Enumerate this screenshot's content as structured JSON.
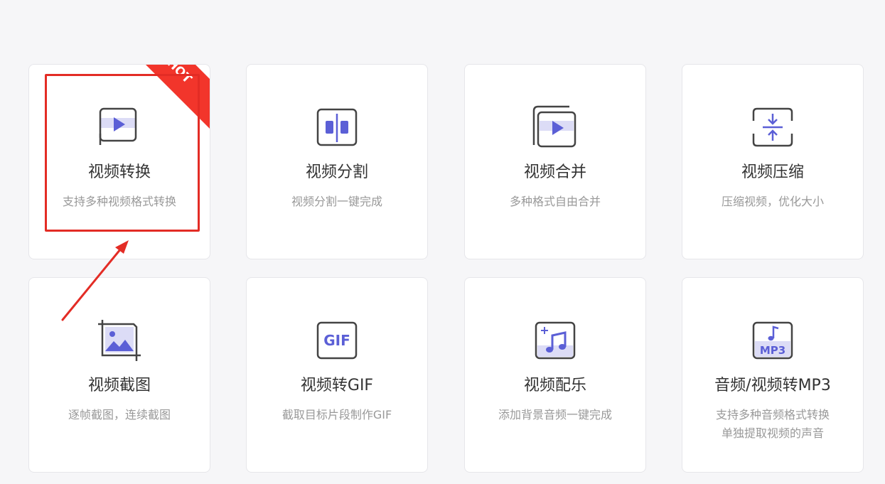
{
  "accent_color": "#5b5fd6",
  "hot_color": "#f2352b",
  "cards": [
    {
      "title": "视频转换",
      "desc": [
        "支持多种视频格式转换"
      ],
      "icon": "video-convert-icon",
      "badge": "HOT"
    },
    {
      "title": "视频分割",
      "desc": [
        "视频分割一键完成"
      ],
      "icon": "video-split-icon"
    },
    {
      "title": "视频合并",
      "desc": [
        "多种格式自由合并"
      ],
      "icon": "video-merge-icon"
    },
    {
      "title": "视频压缩",
      "desc": [
        "压缩视频，优化大小"
      ],
      "icon": "video-compress-icon"
    },
    {
      "title": "视频截图",
      "desc": [
        "逐帧截图，连续截图"
      ],
      "icon": "video-screenshot-icon"
    },
    {
      "title": "视频转GIF",
      "desc": [
        "截取目标片段制作GIF"
      ],
      "icon": "gif-icon",
      "icon_text": "GIF"
    },
    {
      "title": "视频配乐",
      "desc": [
        "添加背景音频一键完成"
      ],
      "icon": "music-note-icon"
    },
    {
      "title": "音频/视频转MP3",
      "desc": [
        "支持多种音频格式转换",
        "单独提取视频的声音"
      ],
      "icon": "mp3-icon",
      "icon_text": "MP3"
    }
  ]
}
